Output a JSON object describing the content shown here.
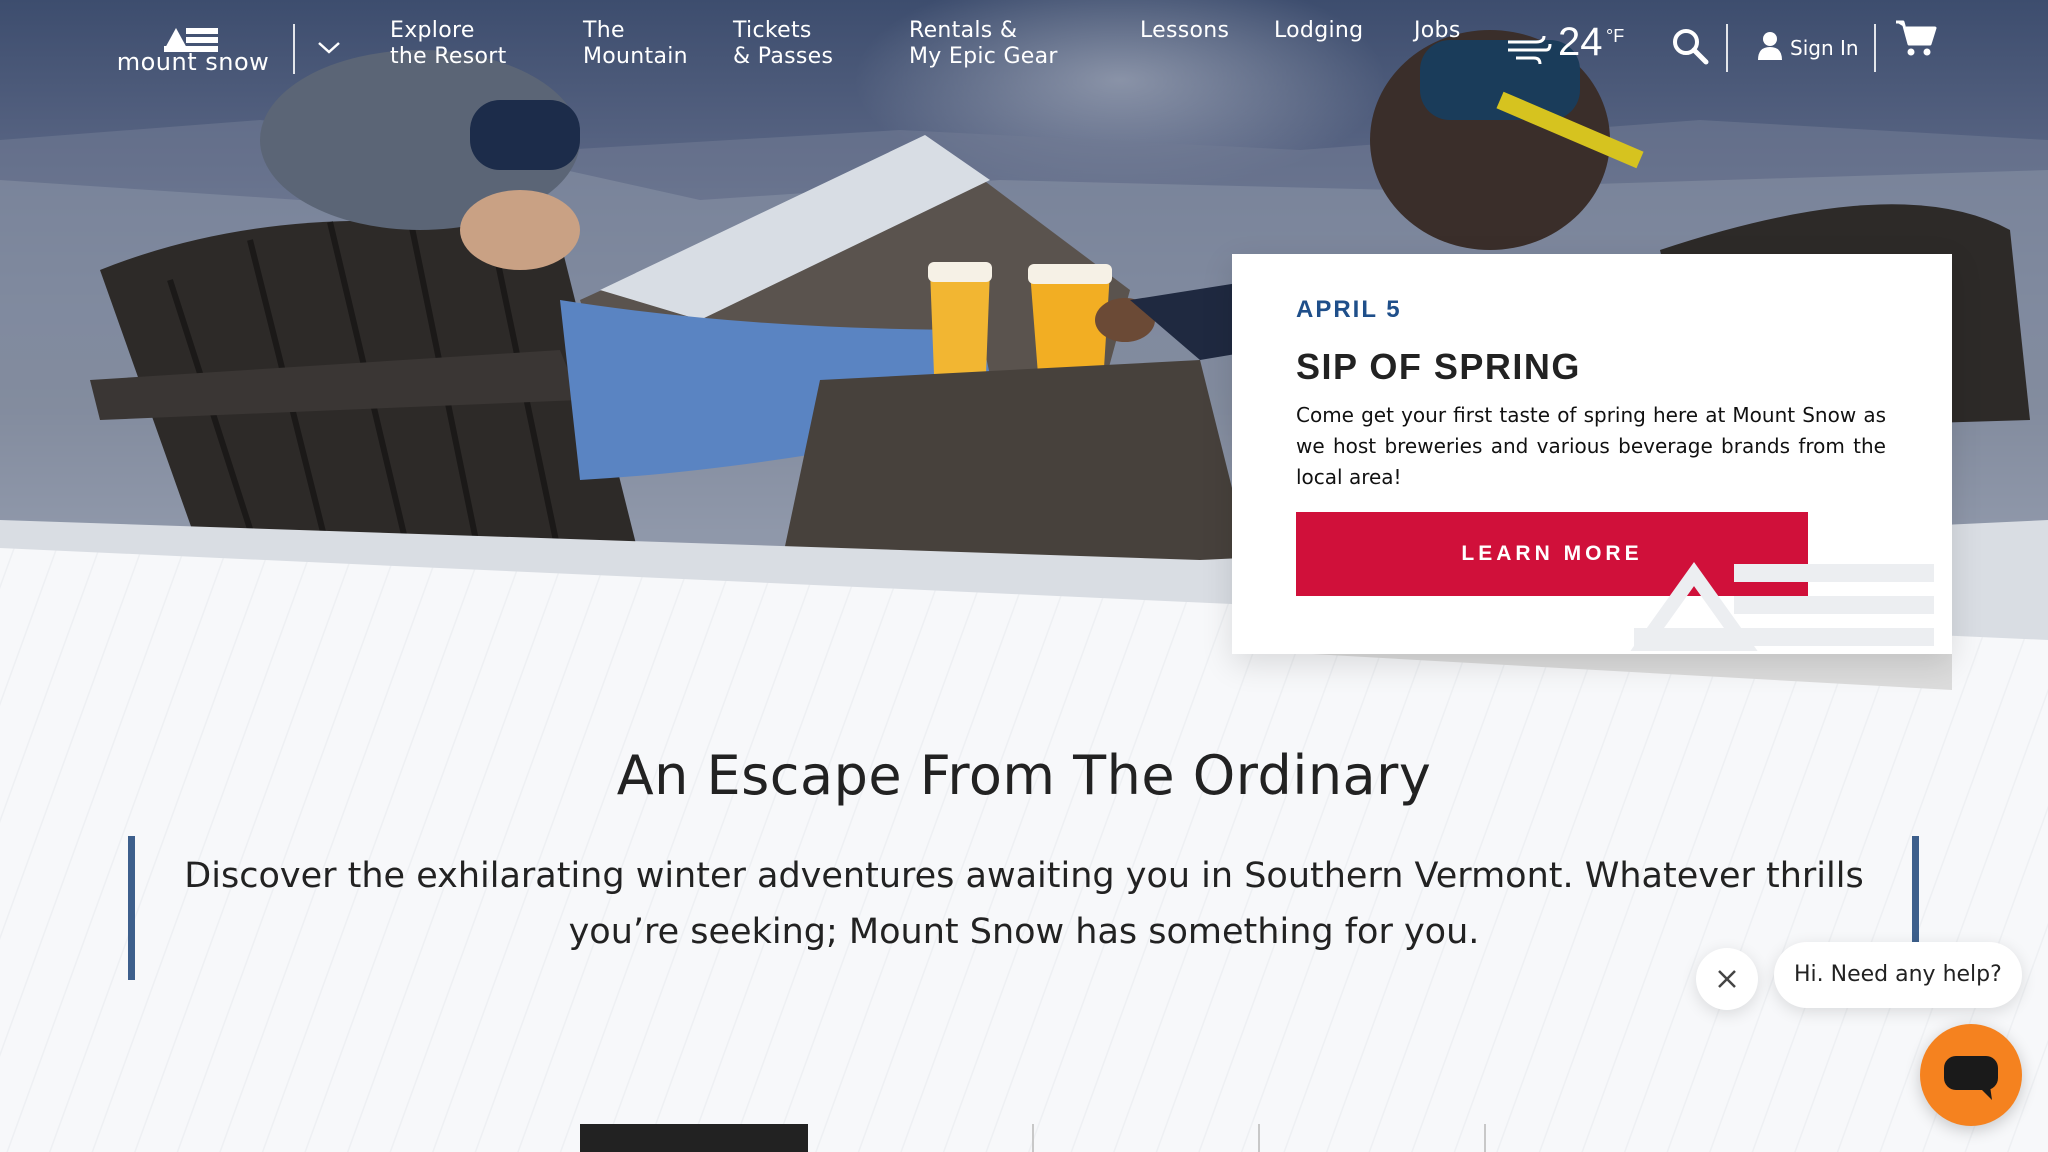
{
  "brand": {
    "name": "mount snow"
  },
  "nav": {
    "items": [
      {
        "label": "Explore\nthe Resort"
      },
      {
        "label": "The\nMountain"
      },
      {
        "label": "Tickets\n& Passes"
      },
      {
        "label": "Rentals &\nMy Epic Gear"
      },
      {
        "label": "Lessons"
      },
      {
        "label": "Lodging"
      },
      {
        "label": "Jobs"
      }
    ],
    "weather": {
      "temp": "24",
      "unit": "°F",
      "icon": "wind-icon"
    },
    "sign_in": "Sign In",
    "icons": {
      "search": "search-icon",
      "cart": "cart-icon",
      "user": "user-icon",
      "menu": "chevron-down-icon"
    }
  },
  "promo": {
    "date": "APRIL 5",
    "title": "SIP OF SPRING",
    "body": "Come get your first taste of spring here at Mount Snow as we host breweries and various beverage brands from the local area!",
    "cta": "LEARN MORE"
  },
  "intro": {
    "title": "An Escape From The Ordinary",
    "text": "Discover the exhilarating winter adventures awaiting you in Southern Vermont. Whatever thrills you’re seeking; Mount Snow has something for you."
  },
  "chat": {
    "greeting": "Hi. Need any help?",
    "icons": {
      "close": "close-icon",
      "launcher": "chat-icon"
    }
  },
  "colors": {
    "accent_red": "#d0103a",
    "date_blue": "#1f4f8a",
    "bar_blue": "#3d5f8c",
    "chat_orange": "#f5821f"
  }
}
